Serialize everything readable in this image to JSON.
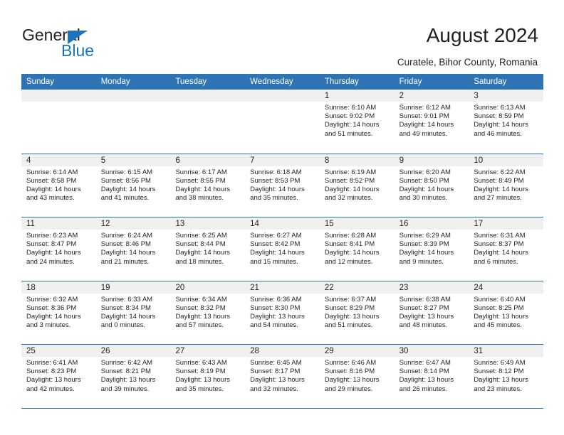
{
  "brand": {
    "name_part1": "General",
    "name_part2": "Blue",
    "accent_color": "#1b75bc",
    "logo_icon": "triangle-icon"
  },
  "header": {
    "title": "August 2024",
    "location": "Curatele, Bihor County, Romania"
  },
  "colors": {
    "header_bar": "#2e74b5",
    "row_band": "#f0f0f0",
    "text": "#231f20"
  },
  "calendar": {
    "weekdays": [
      "Sunday",
      "Monday",
      "Tuesday",
      "Wednesday",
      "Thursday",
      "Friday",
      "Saturday"
    ],
    "weeks": [
      [
        {
          "day": "",
          "empty": true
        },
        {
          "day": "",
          "empty": true
        },
        {
          "day": "",
          "empty": true
        },
        {
          "day": "",
          "empty": true
        },
        {
          "day": "1",
          "sunrise": "Sunrise: 6:10 AM",
          "sunset": "Sunset: 9:02 PM",
          "daylight1": "Daylight: 14 hours",
          "daylight2": "and 51 minutes."
        },
        {
          "day": "2",
          "sunrise": "Sunrise: 6:12 AM",
          "sunset": "Sunset: 9:01 PM",
          "daylight1": "Daylight: 14 hours",
          "daylight2": "and 49 minutes."
        },
        {
          "day": "3",
          "sunrise": "Sunrise: 6:13 AM",
          "sunset": "Sunset: 8:59 PM",
          "daylight1": "Daylight: 14 hours",
          "daylight2": "and 46 minutes."
        }
      ],
      [
        {
          "day": "4",
          "sunrise": "Sunrise: 6:14 AM",
          "sunset": "Sunset: 8:58 PM",
          "daylight1": "Daylight: 14 hours",
          "daylight2": "and 43 minutes."
        },
        {
          "day": "5",
          "sunrise": "Sunrise: 6:15 AM",
          "sunset": "Sunset: 8:56 PM",
          "daylight1": "Daylight: 14 hours",
          "daylight2": "and 41 minutes."
        },
        {
          "day": "6",
          "sunrise": "Sunrise: 6:17 AM",
          "sunset": "Sunset: 8:55 PM",
          "daylight1": "Daylight: 14 hours",
          "daylight2": "and 38 minutes."
        },
        {
          "day": "7",
          "sunrise": "Sunrise: 6:18 AM",
          "sunset": "Sunset: 8:53 PM",
          "daylight1": "Daylight: 14 hours",
          "daylight2": "and 35 minutes."
        },
        {
          "day": "8",
          "sunrise": "Sunrise: 6:19 AM",
          "sunset": "Sunset: 8:52 PM",
          "daylight1": "Daylight: 14 hours",
          "daylight2": "and 32 minutes."
        },
        {
          "day": "9",
          "sunrise": "Sunrise: 6:20 AM",
          "sunset": "Sunset: 8:50 PM",
          "daylight1": "Daylight: 14 hours",
          "daylight2": "and 30 minutes."
        },
        {
          "day": "10",
          "sunrise": "Sunrise: 6:22 AM",
          "sunset": "Sunset: 8:49 PM",
          "daylight1": "Daylight: 14 hours",
          "daylight2": "and 27 minutes."
        }
      ],
      [
        {
          "day": "11",
          "sunrise": "Sunrise: 6:23 AM",
          "sunset": "Sunset: 8:47 PM",
          "daylight1": "Daylight: 14 hours",
          "daylight2": "and 24 minutes."
        },
        {
          "day": "12",
          "sunrise": "Sunrise: 6:24 AM",
          "sunset": "Sunset: 8:46 PM",
          "daylight1": "Daylight: 14 hours",
          "daylight2": "and 21 minutes."
        },
        {
          "day": "13",
          "sunrise": "Sunrise: 6:25 AM",
          "sunset": "Sunset: 8:44 PM",
          "daylight1": "Daylight: 14 hours",
          "daylight2": "and 18 minutes."
        },
        {
          "day": "14",
          "sunrise": "Sunrise: 6:27 AM",
          "sunset": "Sunset: 8:42 PM",
          "daylight1": "Daylight: 14 hours",
          "daylight2": "and 15 minutes."
        },
        {
          "day": "15",
          "sunrise": "Sunrise: 6:28 AM",
          "sunset": "Sunset: 8:41 PM",
          "daylight1": "Daylight: 14 hours",
          "daylight2": "and 12 minutes."
        },
        {
          "day": "16",
          "sunrise": "Sunrise: 6:29 AM",
          "sunset": "Sunset: 8:39 PM",
          "daylight1": "Daylight: 14 hours",
          "daylight2": "and 9 minutes."
        },
        {
          "day": "17",
          "sunrise": "Sunrise: 6:31 AM",
          "sunset": "Sunset: 8:37 PM",
          "daylight1": "Daylight: 14 hours",
          "daylight2": "and 6 minutes."
        }
      ],
      [
        {
          "day": "18",
          "sunrise": "Sunrise: 6:32 AM",
          "sunset": "Sunset: 8:36 PM",
          "daylight1": "Daylight: 14 hours",
          "daylight2": "and 3 minutes."
        },
        {
          "day": "19",
          "sunrise": "Sunrise: 6:33 AM",
          "sunset": "Sunset: 8:34 PM",
          "daylight1": "Daylight: 14 hours",
          "daylight2": "and 0 minutes."
        },
        {
          "day": "20",
          "sunrise": "Sunrise: 6:34 AM",
          "sunset": "Sunset: 8:32 PM",
          "daylight1": "Daylight: 13 hours",
          "daylight2": "and 57 minutes."
        },
        {
          "day": "21",
          "sunrise": "Sunrise: 6:36 AM",
          "sunset": "Sunset: 8:30 PM",
          "daylight1": "Daylight: 13 hours",
          "daylight2": "and 54 minutes."
        },
        {
          "day": "22",
          "sunrise": "Sunrise: 6:37 AM",
          "sunset": "Sunset: 8:29 PM",
          "daylight1": "Daylight: 13 hours",
          "daylight2": "and 51 minutes."
        },
        {
          "day": "23",
          "sunrise": "Sunrise: 6:38 AM",
          "sunset": "Sunset: 8:27 PM",
          "daylight1": "Daylight: 13 hours",
          "daylight2": "and 48 minutes."
        },
        {
          "day": "24",
          "sunrise": "Sunrise: 6:40 AM",
          "sunset": "Sunset: 8:25 PM",
          "daylight1": "Daylight: 13 hours",
          "daylight2": "and 45 minutes."
        }
      ],
      [
        {
          "day": "25",
          "sunrise": "Sunrise: 6:41 AM",
          "sunset": "Sunset: 8:23 PM",
          "daylight1": "Daylight: 13 hours",
          "daylight2": "and 42 minutes."
        },
        {
          "day": "26",
          "sunrise": "Sunrise: 6:42 AM",
          "sunset": "Sunset: 8:21 PM",
          "daylight1": "Daylight: 13 hours",
          "daylight2": "and 39 minutes."
        },
        {
          "day": "27",
          "sunrise": "Sunrise: 6:43 AM",
          "sunset": "Sunset: 8:19 PM",
          "daylight1": "Daylight: 13 hours",
          "daylight2": "and 35 minutes."
        },
        {
          "day": "28",
          "sunrise": "Sunrise: 6:45 AM",
          "sunset": "Sunset: 8:17 PM",
          "daylight1": "Daylight: 13 hours",
          "daylight2": "and 32 minutes."
        },
        {
          "day": "29",
          "sunrise": "Sunrise: 6:46 AM",
          "sunset": "Sunset: 8:16 PM",
          "daylight1": "Daylight: 13 hours",
          "daylight2": "and 29 minutes."
        },
        {
          "day": "30",
          "sunrise": "Sunrise: 6:47 AM",
          "sunset": "Sunset: 8:14 PM",
          "daylight1": "Daylight: 13 hours",
          "daylight2": "and 26 minutes."
        },
        {
          "day": "31",
          "sunrise": "Sunrise: 6:49 AM",
          "sunset": "Sunset: 8:12 PM",
          "daylight1": "Daylight: 13 hours",
          "daylight2": "and 23 minutes."
        }
      ]
    ]
  }
}
